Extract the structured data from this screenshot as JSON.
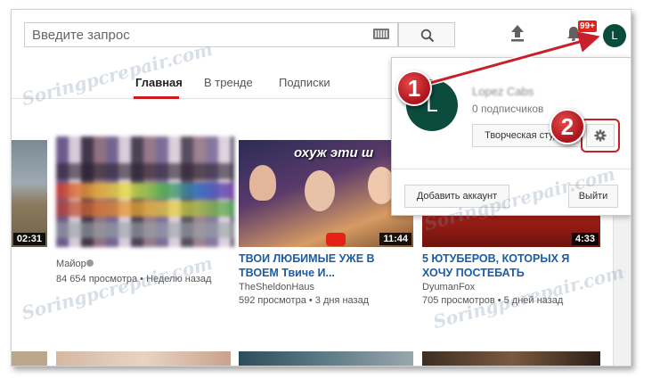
{
  "search": {
    "placeholder": "Введите запрос"
  },
  "header": {
    "notification_badge": "99+",
    "avatar_letter": "L"
  },
  "tabs": [
    {
      "label": "Главная",
      "active": true
    },
    {
      "label": "В тренде",
      "active": false
    },
    {
      "label": "Подписки",
      "active": false
    }
  ],
  "videos": [
    {
      "duration": "02:31",
      "title": "",
      "channel": "",
      "meta": ""
    },
    {
      "duration": "",
      "title": "",
      "channel": "Майор",
      "meta": "84 654 просмотра • Неделю назад"
    },
    {
      "duration": "11:44",
      "title": "ТВОИ ЛЮБИМЫЕ УЖЕ В ТВОЕМ Твиче И...",
      "channel": "TheSheldonHaus",
      "meta": "592 просмотра • 3 дня назад",
      "thumb_text": "охуж эти ш"
    },
    {
      "duration": "4:33",
      "title": "5 ЮТУБЕРОВ, КОТОРЫХ Я ХОЧУ ПОСТЕБАТЬ",
      "channel": "DyumanFox",
      "meta": "705 просмотров • 5 дней назад"
    }
  ],
  "popup": {
    "avatar_letter": "L",
    "name": "Lopez Cabs",
    "subscribers": "0 подписчиков",
    "studio_button": "Творческая студия",
    "add_account_button": "Добавить аккаунт",
    "logout_button": "Выйти"
  },
  "callouts": {
    "one": "1",
    "two": "2"
  },
  "watermark": "Soringpcrepair.com",
  "colors": {
    "accent": "#cc181e",
    "link": "#1a5da6",
    "avatar": "#0b4c3e",
    "callout": "#c8202a"
  }
}
